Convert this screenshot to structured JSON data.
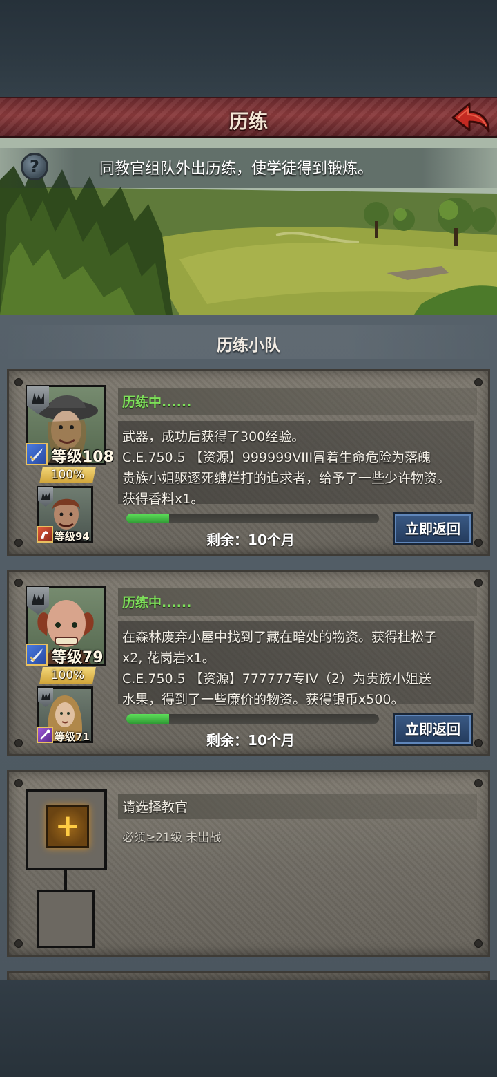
{
  "header": {
    "title": "历练"
  },
  "banner": {
    "description": "同教官组队外出历练，使学徒得到锻炼。"
  },
  "section": {
    "title": "历练小队"
  },
  "teams": [
    {
      "status": "历练中......",
      "mentor": {
        "level_label": "等级108",
        "weapon": "sword-icon"
      },
      "bond_percent": "100%",
      "apprentice": {
        "level_label": "等级94",
        "weapon": "horse-icon"
      },
      "log": [
        "武器，成功后获得了300经验。",
        "C.E.750.5 【资源】999999VIII冒着生命危险为落魄",
        "贵族小姐驱逐死缠烂打的追求者，给予了一些少许物资。",
        "获得香料x1。"
      ],
      "progress": 0.17,
      "remaining": "剩余：10个月",
      "return_label": "立即返回"
    },
    {
      "status": "历练中......",
      "mentor": {
        "level_label": "等级79",
        "weapon": "sword-icon"
      },
      "bond_percent": "100%",
      "apprentice": {
        "level_label": "等级71",
        "weapon": "staff-icon"
      },
      "log": [
        "在森林废弃小屋中找到了藏在暗处的物资。获得杜松子",
        "x2, 花岗岩x1。",
        "C.E.750.5 【资源】777777专IV（2）为贵族小姐送",
        "水果，得到了一些廉价的物资。获得银币x500。"
      ],
      "progress": 0.17,
      "remaining": "剩余：10个月",
      "return_label": "立即返回"
    }
  ],
  "empty_slot": {
    "title": "请选择教官",
    "requirement": "必须≥21级 未出战",
    "add_symbol": "+"
  },
  "colors": {
    "title_bar": "#7a3033",
    "status_green": "#7ee05a",
    "progress_green": "#3fbf45",
    "button_blue": "#2e4c76"
  }
}
